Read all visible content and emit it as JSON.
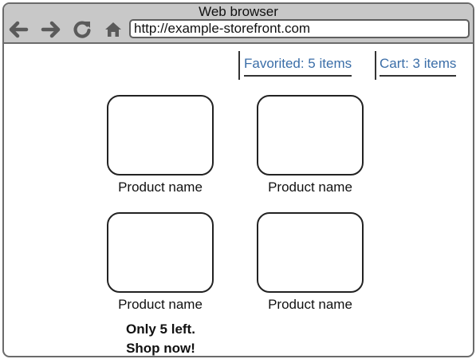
{
  "window": {
    "title": "Web browser"
  },
  "toolbar": {
    "icons": [
      "back-arrow-icon",
      "forward-arrow-icon",
      "reload-icon",
      "home-icon"
    ],
    "address": "http://example-storefront.com"
  },
  "header_links": {
    "favorited": "Favorited: 5 items",
    "cart": "Cart: 3 items",
    "link_color": "#3b6ea8"
  },
  "products": [
    {
      "name": "Product name"
    },
    {
      "name": "Product name"
    },
    {
      "name": "Product name"
    },
    {
      "name": "Product name"
    }
  ],
  "promo": {
    "line1": "Only 5 left.",
    "line2": "Shop now!"
  }
}
